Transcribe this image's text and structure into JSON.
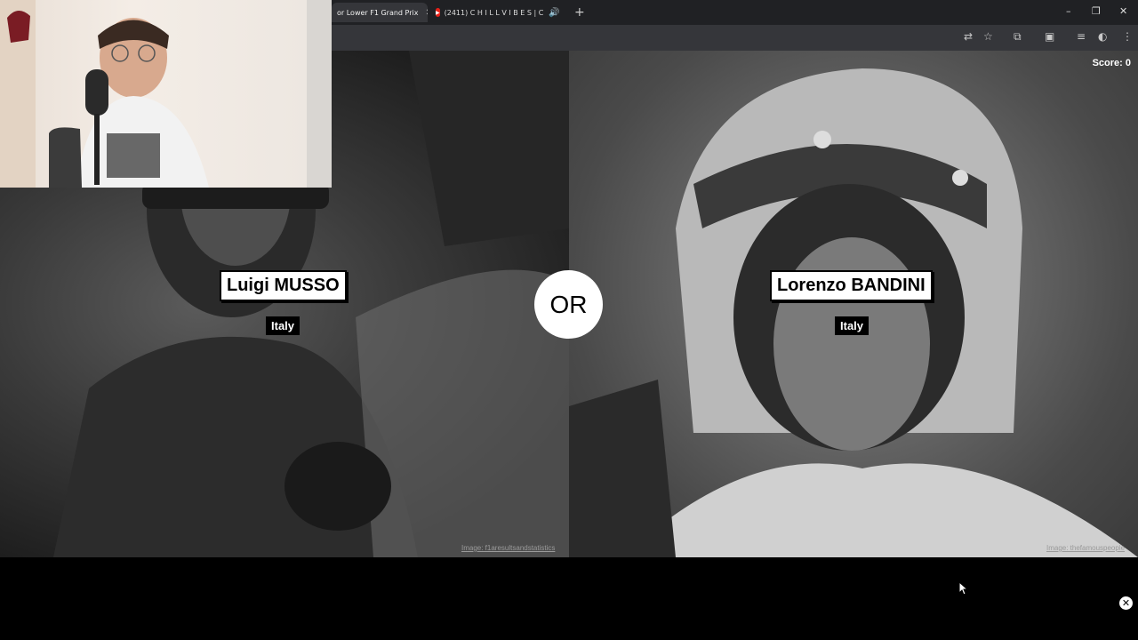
{
  "browser": {
    "tabs": [
      {
        "label": "or Lower F1 Grand Prix",
        "active": true
      },
      {
        "label": "(2411) C H I L L V I B E S | C",
        "active": false
      }
    ],
    "new_tab": "+",
    "window_controls": {
      "minimize": "–",
      "restore": "❐",
      "close": "✕"
    }
  },
  "game": {
    "score_label": "Score: 0",
    "or_label": "OR",
    "left": {
      "name": "Luigi MUSSO",
      "country": "Italy",
      "credit": "Image: f1aresultsandstatistics"
    },
    "right": {
      "name": "Lorenzo BANDINI",
      "country": "Italy",
      "credit": "Image: thefamouspeople"
    }
  },
  "overlay": {
    "close_icon": "✕"
  },
  "colors": {
    "tab_bar": "#202124",
    "toolbar": "#35363a",
    "or_circle": "#ffffff",
    "name_box": "#ffffff",
    "country_box": "#000000"
  }
}
